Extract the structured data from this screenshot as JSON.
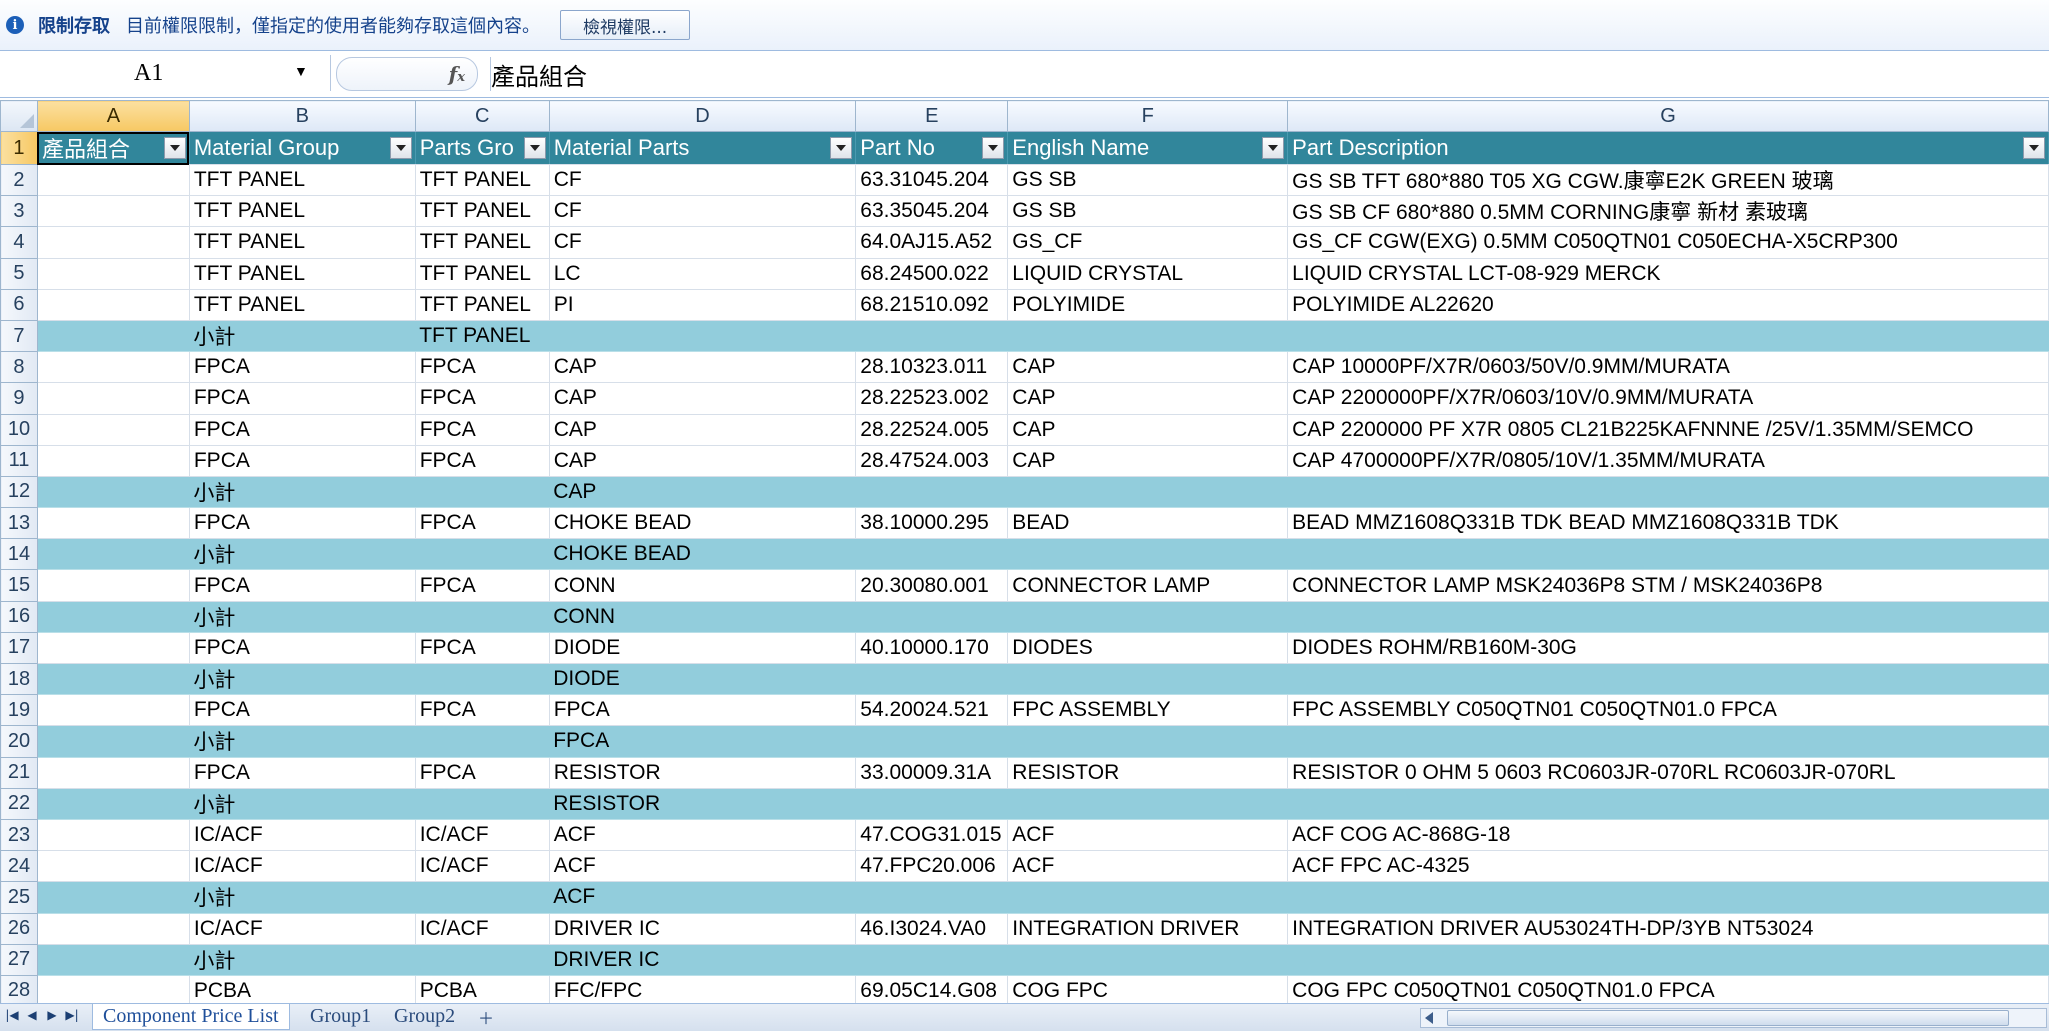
{
  "infobar": {
    "icon": "info-icon",
    "title": "限制存取",
    "message": "目前權限限制，僅指定的使用者能夠存取這個內容。",
    "button": "檢視權限..."
  },
  "formula": {
    "cell_ref": "A1",
    "fx": "fx",
    "content": "產品組合"
  },
  "columns": [
    "A",
    "B",
    "C",
    "D",
    "E",
    "F",
    "G"
  ],
  "header": [
    "產品組合",
    "Material Group",
    "Parts Gro",
    "Material Parts",
    "Part No",
    "English Name",
    "Part Description"
  ],
  "rows": [
    {
      "n": "2",
      "sub": false,
      "c": [
        "",
        "TFT PANEL",
        "TFT PANEL",
        "CF",
        "63.31045.204",
        "GS SB",
        "GS SB TFT 680*880 T05 XG CGW.康寧E2K GREEN 玻璃"
      ]
    },
    {
      "n": "3",
      "sub": false,
      "c": [
        "",
        "TFT PANEL",
        "TFT PANEL",
        "CF",
        "63.35045.204",
        "GS SB",
        "GS SB CF 680*880 0.5MM CORNING康寧 新材 素玻璃"
      ]
    },
    {
      "n": "4",
      "sub": false,
      "c": [
        "",
        "TFT PANEL",
        "TFT PANEL",
        "CF",
        "64.0AJ15.A52",
        "GS_CF",
        "GS_CF CGW(EXG) 0.5MM C050QTN01 C050ECHA-X5CRP300"
      ]
    },
    {
      "n": "5",
      "sub": false,
      "c": [
        "",
        "TFT PANEL",
        "TFT PANEL",
        "LC",
        "68.24500.022",
        "LIQUID CRYSTAL",
        "LIQUID CRYSTAL LCT-08-929  MERCK"
      ]
    },
    {
      "n": "6",
      "sub": false,
      "c": [
        "",
        "TFT PANEL",
        "TFT PANEL",
        "PI",
        "68.21510.092",
        "POLYIMIDE",
        "POLYIMIDE AL22620"
      ]
    },
    {
      "n": "7",
      "sub": true,
      "c": [
        "",
        "小計",
        "TFT PANEL",
        "",
        "",
        "",
        ""
      ]
    },
    {
      "n": "8",
      "sub": false,
      "c": [
        "",
        "FPCA",
        "FPCA",
        "CAP",
        "28.10323.011",
        "CAP",
        "CAP 10000PF/X7R/0603/50V/0.9MM/MURATA"
      ]
    },
    {
      "n": "9",
      "sub": false,
      "c": [
        "",
        "FPCA",
        "FPCA",
        "CAP",
        "28.22523.002",
        "CAP",
        "CAP 2200000PF/X7R/0603/10V/0.9MM/MURATA"
      ]
    },
    {
      "n": "10",
      "sub": false,
      "c": [
        "",
        "FPCA",
        "FPCA",
        "CAP",
        "28.22524.005",
        "CAP",
        "CAP 2200000 PF X7R 0805 CL21B225KAFNNNE /25V/1.35MM/SEMCO"
      ]
    },
    {
      "n": "11",
      "sub": false,
      "c": [
        "",
        "FPCA",
        "FPCA",
        "CAP",
        "28.47524.003",
        "CAP",
        "CAP 4700000PF/X7R/0805/10V/1.35MM/MURATA"
      ]
    },
    {
      "n": "12",
      "sub": true,
      "c": [
        "",
        "小計",
        "",
        "CAP",
        "",
        "",
        ""
      ]
    },
    {
      "n": "13",
      "sub": false,
      "c": [
        "",
        "FPCA",
        "FPCA",
        "CHOKE BEAD",
        "38.10000.295",
        "BEAD",
        "BEAD MMZ1608Q331B TDK BEAD MMZ1608Q331B TDK"
      ]
    },
    {
      "n": "14",
      "sub": true,
      "c": [
        "",
        "小計",
        "",
        "CHOKE BEAD",
        "",
        "",
        ""
      ]
    },
    {
      "n": "15",
      "sub": false,
      "c": [
        "",
        "FPCA",
        "FPCA",
        "CONN",
        "20.30080.001",
        "CONNECTOR LAMP",
        "CONNECTOR LAMP MSK24036P8 STM / MSK24036P8"
      ]
    },
    {
      "n": "16",
      "sub": true,
      "c": [
        "",
        "小計",
        "",
        "CONN",
        "",
        "",
        ""
      ]
    },
    {
      "n": "17",
      "sub": false,
      "c": [
        "",
        "FPCA",
        "FPCA",
        "DIODE",
        "40.10000.170",
        "DIODES",
        "DIODES ROHM/RB160M-30G"
      ]
    },
    {
      "n": "18",
      "sub": true,
      "c": [
        "",
        "小計",
        "",
        "DIODE",
        "",
        "",
        ""
      ]
    },
    {
      "n": "19",
      "sub": false,
      "c": [
        "",
        "FPCA",
        "FPCA",
        "FPCA",
        "54.20024.521",
        "FPC ASSEMBLY",
        "FPC ASSEMBLY C050QTN01 C050QTN01.0 FPCA"
      ]
    },
    {
      "n": "20",
      "sub": true,
      "c": [
        "",
        "小計",
        "",
        "FPCA",
        "",
        "",
        ""
      ]
    },
    {
      "n": "21",
      "sub": false,
      "c": [
        "",
        "FPCA",
        "FPCA",
        "RESISTOR",
        "33.00009.31A",
        "RESISTOR",
        "RESISTOR 0 OHM 5 0603 RC0603JR-070RL RC0603JR-070RL"
      ]
    },
    {
      "n": "22",
      "sub": true,
      "c": [
        "",
        "小計",
        "",
        "RESISTOR",
        "",
        "",
        ""
      ]
    },
    {
      "n": "23",
      "sub": false,
      "c": [
        "",
        "IC/ACF",
        "IC/ACF",
        "ACF",
        "47.COG31.015",
        "ACF",
        "ACF COG AC-868G-18"
      ]
    },
    {
      "n": "24",
      "sub": false,
      "c": [
        "",
        "IC/ACF",
        "IC/ACF",
        "ACF",
        "47.FPC20.006",
        "ACF",
        "ACF FPC AC-4325"
      ]
    },
    {
      "n": "25",
      "sub": true,
      "c": [
        "",
        "小計",
        "",
        "ACF",
        "",
        "",
        ""
      ]
    },
    {
      "n": "26",
      "sub": false,
      "c": [
        "",
        "IC/ACF",
        "IC/ACF",
        "DRIVER IC",
        "46.I3024.VA0",
        "INTEGRATION DRIVER",
        "INTEGRATION DRIVER AU53024TH-DP/3YB NT53024"
      ]
    },
    {
      "n": "27",
      "sub": true,
      "c": [
        "",
        "小計",
        "",
        "DRIVER IC",
        "",
        "",
        ""
      ]
    },
    {
      "n": "28",
      "sub": false,
      "c": [
        "",
        "PCBA",
        "PCBA",
        "FFC/FPC",
        "69.05C14.G08",
        "COG FPC",
        "COG FPC C050QTN01 C050QTN01.0 FPCA"
      ]
    }
  ],
  "sheets": [
    "Component Price List",
    "Group1",
    "Group2"
  ],
  "active_sheet": "Component Price List",
  "colors": {
    "header_fill": "#31869b",
    "subtotal_fill": "#92cddc"
  }
}
